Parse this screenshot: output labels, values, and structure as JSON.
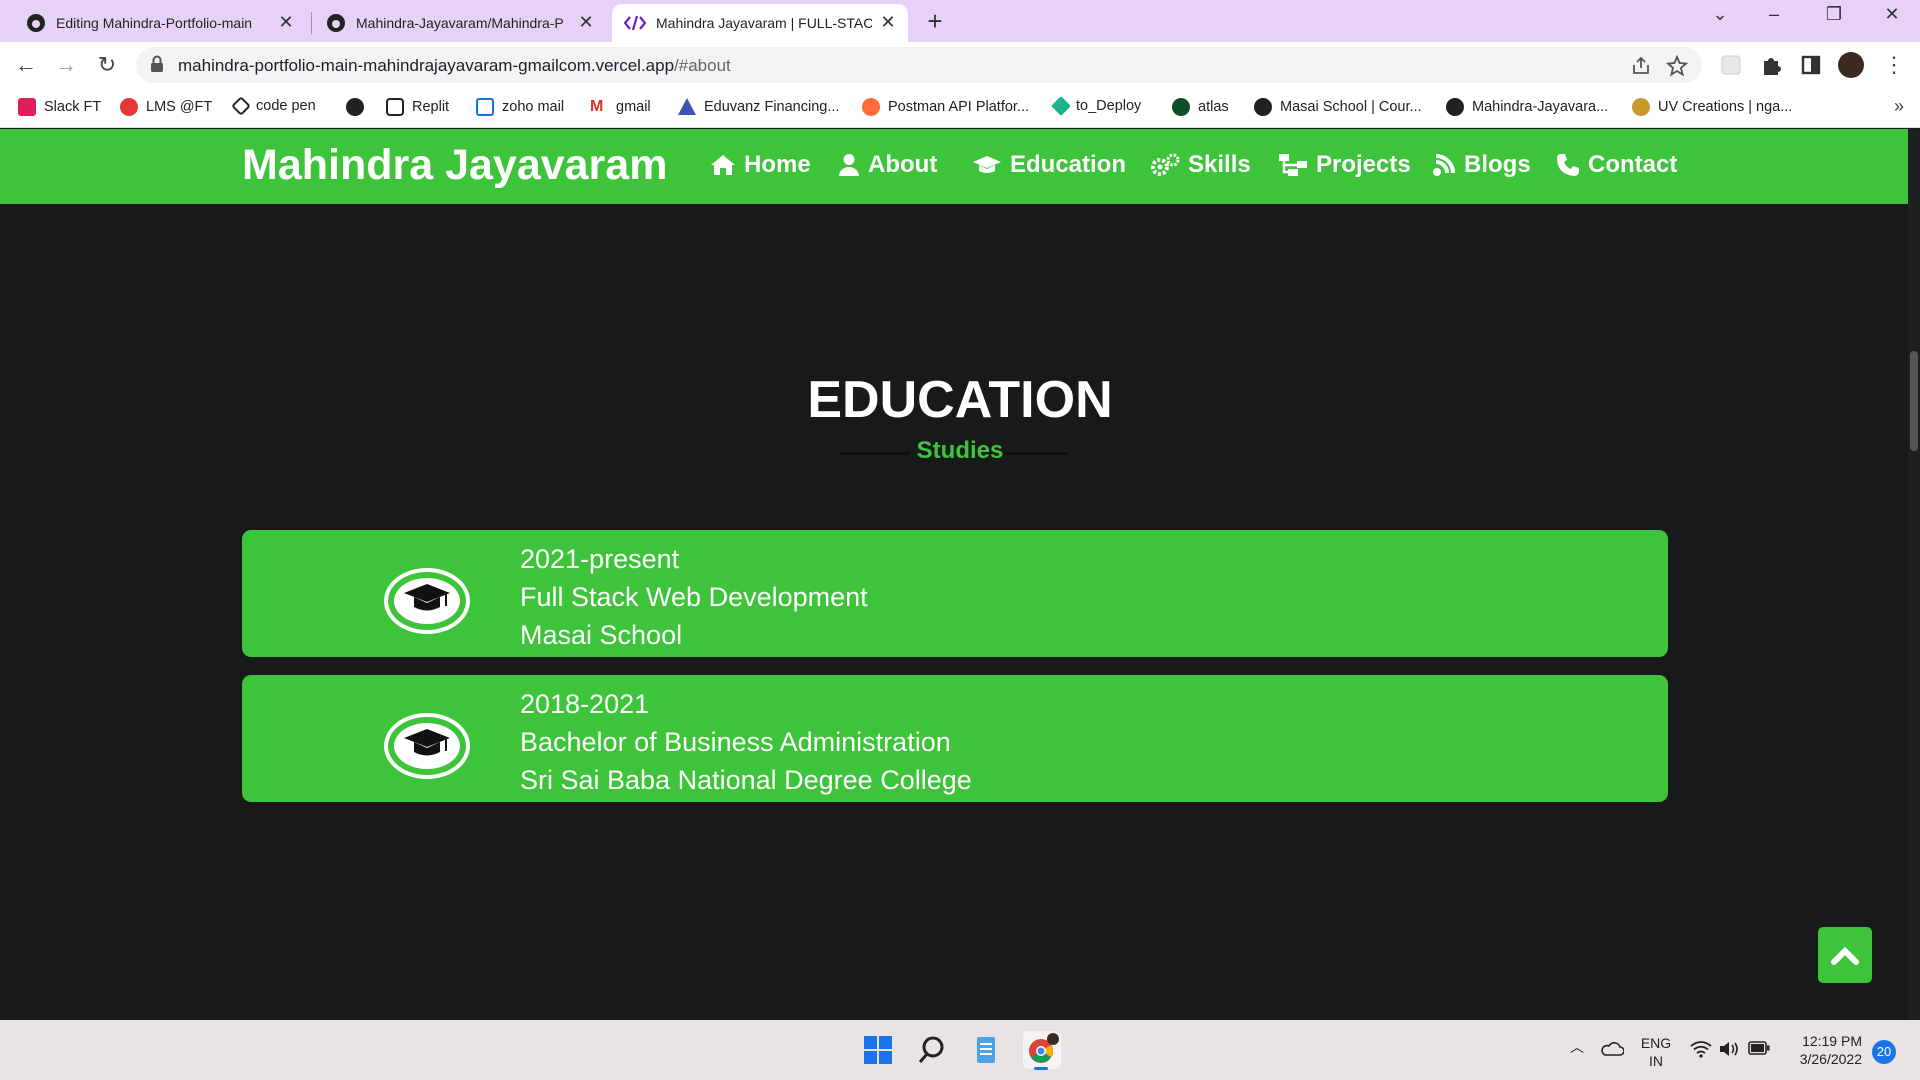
{
  "browser": {
    "tabs": [
      {
        "title": "Editing Mahindra-Portfolio-main",
        "icon": "github-icon",
        "active": false
      },
      {
        "title": "Mahindra-Jayavaram/Mahindra-P",
        "icon": "github-icon",
        "active": false
      },
      {
        "title": "Mahindra Jayavaram | FULL-STAC",
        "icon": "code-icon",
        "active": true
      }
    ],
    "url_host": "mahindra-portfolio-main-mahindrajayavaram-gmailcom.vercel.app",
    "url_path": "/#about",
    "bookmarks": [
      {
        "label": "Slack FT",
        "icon": "slack-icon",
        "color": "#e01e5a"
      },
      {
        "label": "LMS @FT",
        "icon": "lms-icon",
        "color": "#e53935"
      },
      {
        "label": "code pen",
        "icon": "codepen-icon",
        "color": "#222222"
      },
      {
        "label": "",
        "icon": "globe-icon",
        "color": "#222222"
      },
      {
        "label": "Replit",
        "icon": "replit-icon",
        "color": "#222222"
      },
      {
        "label": "zoho mail",
        "icon": "mail-icon",
        "color": "#1a73e8"
      },
      {
        "label": "gmail",
        "icon": "gmail-icon",
        "color": "#d93025"
      },
      {
        "label": "Eduvanz Financing...",
        "icon": "eduvanz-icon",
        "color": "#3f51b5"
      },
      {
        "label": "Postman API Platfor...",
        "icon": "postman-icon",
        "color": "#ff6c37"
      },
      {
        "label": "to_Deploy",
        "icon": "diamond-icon",
        "color": "#1bb38a"
      },
      {
        "label": "atlas",
        "icon": "mongodb-icon",
        "color": "#0d4f2a"
      },
      {
        "label": "Masai School | Cour...",
        "icon": "globe-icon",
        "color": "#222222"
      },
      {
        "label": "Mahindra-Jayavara...",
        "icon": "github-icon",
        "color": "#222222"
      },
      {
        "label": "UV Creations | nga...",
        "icon": "uv-icon",
        "color": "#c79a2a"
      }
    ],
    "bookmarks_more": "»"
  },
  "site": {
    "logo": "Mahindra Jayavaram",
    "nav": [
      {
        "label": "Home",
        "icon": "home-icon"
      },
      {
        "label": "About",
        "icon": "user-icon"
      },
      {
        "label": "Education",
        "icon": "graduation-cap-icon"
      },
      {
        "label": "Skills",
        "icon": "gears-icon"
      },
      {
        "label": "Projects",
        "icon": "sitemap-icon"
      },
      {
        "label": "Blogs",
        "icon": "blog-icon"
      },
      {
        "label": "Contact",
        "icon": "phone-icon"
      }
    ],
    "accent": "#3dc43a",
    "background": "#18191b"
  },
  "education": {
    "heading": "EDUCATION",
    "subheading": "Studies",
    "entries": [
      {
        "years": "2021-present",
        "course": "Full Stack Web Development",
        "institution": "Masai School"
      },
      {
        "years": "2018-2021",
        "course": "Bachelor of Business Administration",
        "institution": "Sri Sai Baba National Degree College"
      }
    ]
  },
  "taskbar": {
    "language": "ENG",
    "region": "IN",
    "time": "12:19 PM",
    "date": "3/26/2022",
    "notifications": "20"
  }
}
